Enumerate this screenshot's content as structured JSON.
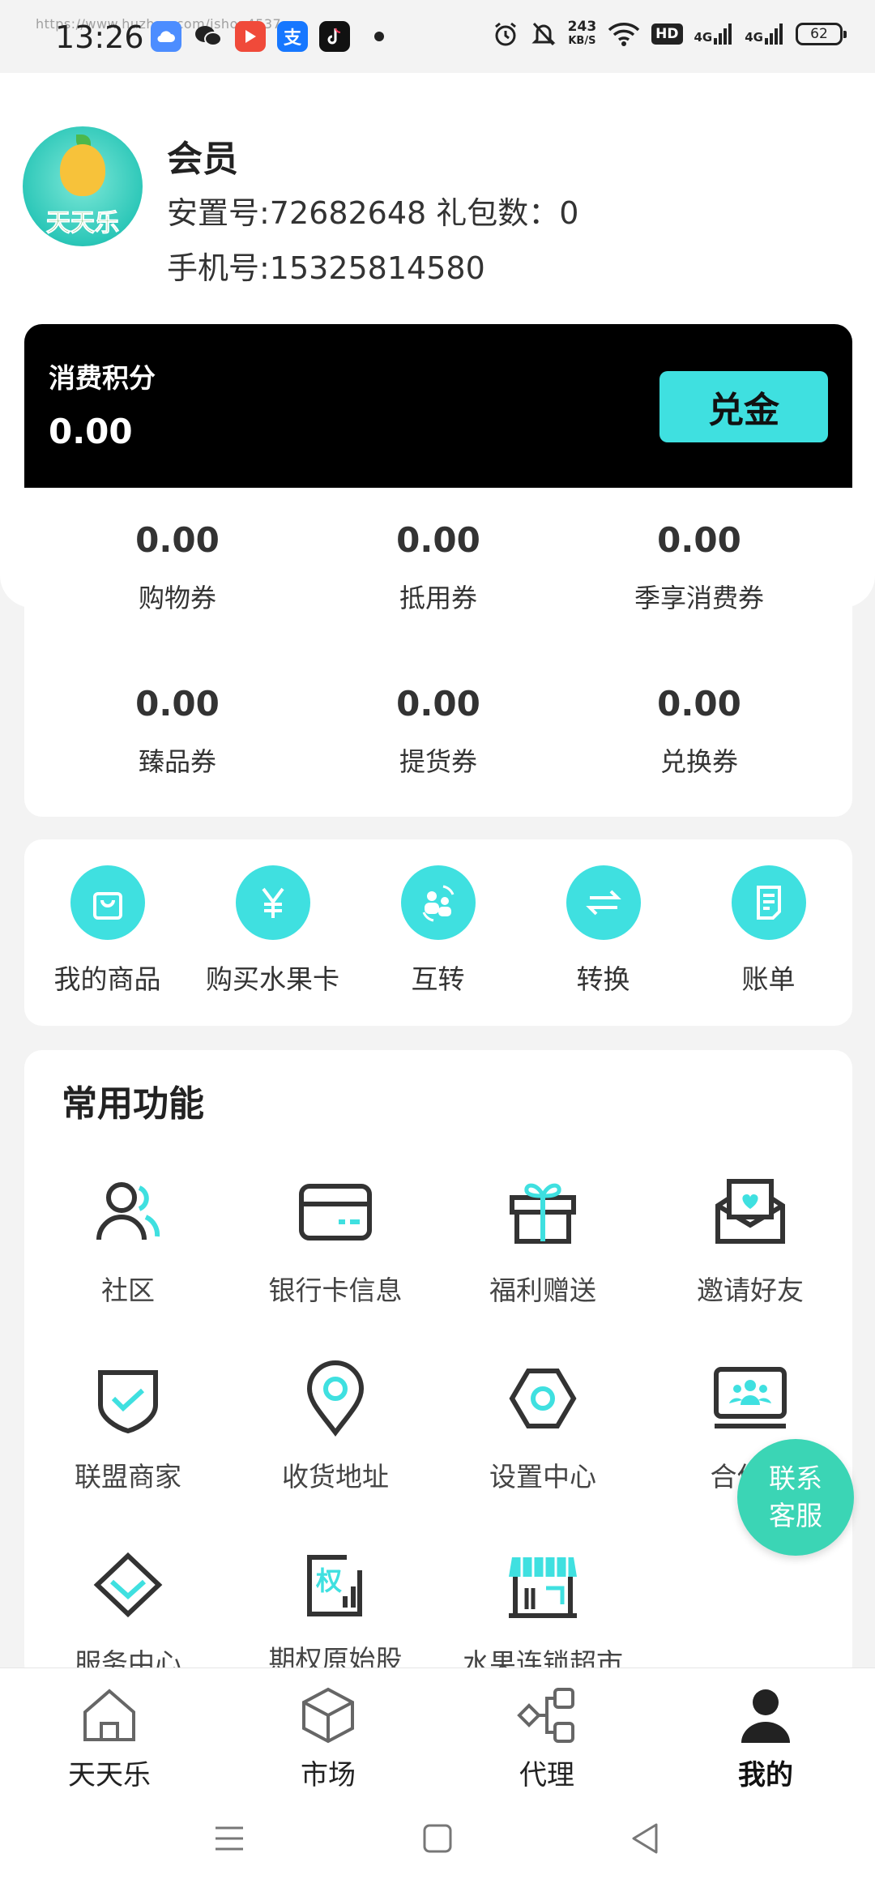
{
  "status_bar": {
    "time": "13:26",
    "url_overlay": "https://www.huzhan.com/ishop4537",
    "net_speed_value": "243",
    "net_speed_unit": "KB/S",
    "hd_badge": "HD",
    "signal1": "4G",
    "signal2": "4G",
    "battery": "62",
    "app_icons": [
      "cloud-app-icon",
      "wechat-icon",
      "video-app-icon",
      "alipay-icon",
      "tiktok-icon"
    ],
    "alipay_glyph": "支"
  },
  "profile": {
    "avatar_logo_text": "天天乐",
    "title": "会员",
    "id_line": "安置号:72682648 礼包数：0",
    "phone_line": "手机号:15325814580"
  },
  "points": {
    "label": "消费积分",
    "value": "0.00",
    "redeem_button": "兑金"
  },
  "coupons": [
    {
      "value": "0.00",
      "label": "购物券"
    },
    {
      "value": "0.00",
      "label": "抵用券"
    },
    {
      "value": "0.00",
      "label": "季享消费券"
    },
    {
      "value": "0.00",
      "label": "臻品券"
    },
    {
      "value": "0.00",
      "label": "提货券"
    },
    {
      "value": "0.00",
      "label": "兑换券"
    }
  ],
  "quick_actions": [
    {
      "label": "我的商品",
      "icon": "shopping-bag-icon"
    },
    {
      "label": "购买水果卡",
      "icon": "yen-icon"
    },
    {
      "label": "互转",
      "icon": "transfer-users-icon"
    },
    {
      "label": "转换",
      "icon": "exchange-arrows-icon"
    },
    {
      "label": "账单",
      "icon": "bill-icon"
    }
  ],
  "common_functions": {
    "title": "常用功能",
    "items": [
      {
        "label": "社区",
        "icon": "community-icon"
      },
      {
        "label": "银行卡信息",
        "icon": "bank-card-icon"
      },
      {
        "label": "福利赠送",
        "icon": "gift-icon"
      },
      {
        "label": "邀请好友",
        "icon": "invite-letter-icon"
      },
      {
        "label": "联盟商家",
        "icon": "shield-check-icon"
      },
      {
        "label": "收货地址",
        "icon": "location-pin-icon"
      },
      {
        "label": "设置中心",
        "icon": "settings-hex-icon"
      },
      {
        "label": "合伙人",
        "icon": "partner-screen-icon"
      },
      {
        "label": "服务中心",
        "icon": "diamond-icon"
      },
      {
        "label": "期权原始股",
        "icon": "option-stock-icon"
      },
      {
        "label": "水果连锁超市",
        "icon": "store-icon"
      }
    ],
    "stock_icon_glyph": "权"
  },
  "customer_service": {
    "line1": "联系",
    "line2": "客服"
  },
  "bottom_nav": [
    {
      "label": "天天乐",
      "icon": "home-icon"
    },
    {
      "label": "市场",
      "icon": "market-cube-icon"
    },
    {
      "label": "代理",
      "icon": "agent-nodes-icon"
    },
    {
      "label": "我的",
      "icon": "profile-icon",
      "active": true
    }
  ],
  "colors": {
    "accent": "#3fe0e0",
    "service_bubble": "#3bd5b5",
    "card_dark": "#000000",
    "background": "#f3f3f3"
  }
}
